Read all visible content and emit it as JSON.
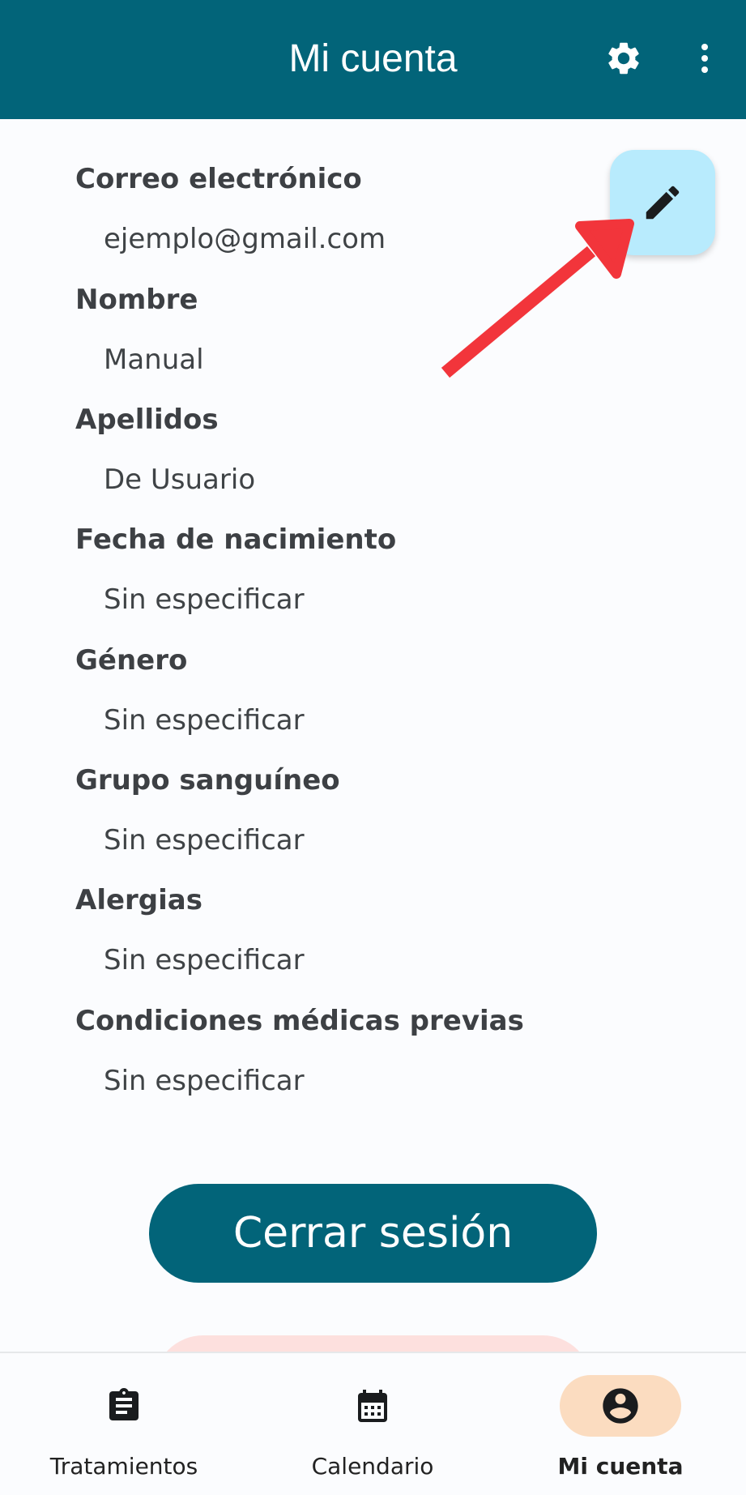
{
  "appbar": {
    "title": "Mi cuenta",
    "settings_icon": "gear-icon",
    "more_icon": "more-vert-icon",
    "color": "#026479"
  },
  "profile": {
    "fields": [
      {
        "label": "Correo electrónico",
        "value": "ejemplo@gmail.com"
      },
      {
        "label": "Nombre",
        "value": "Manual"
      },
      {
        "label": "Apellidos",
        "value": "De Usuario"
      },
      {
        "label": "Fecha de nacimiento",
        "value": "Sin especificar"
      },
      {
        "label": "Género",
        "value": "Sin especificar"
      },
      {
        "label": "Grupo sanguíneo",
        "value": "Sin especificar"
      },
      {
        "label": "Alergias",
        "value": "Sin especificar"
      },
      {
        "label": "Condiciones médicas previas",
        "value": "Sin especificar"
      }
    ],
    "edit_icon": "pencil-icon"
  },
  "actions": {
    "logout_label": "Cerrar sesión",
    "logout_color": "#026479",
    "delete_color": "#fde0de"
  },
  "annotation": {
    "arrow_color": "#f2353b"
  },
  "bottom_nav": {
    "items": [
      {
        "label": "Tratamientos",
        "icon": "clipboard-icon",
        "active": false
      },
      {
        "label": "Calendario",
        "icon": "calendar-icon",
        "active": false
      },
      {
        "label": "Mi cuenta",
        "icon": "account-circle-icon",
        "active": true
      }
    ],
    "active_pill_color": "#fbdcc0"
  }
}
